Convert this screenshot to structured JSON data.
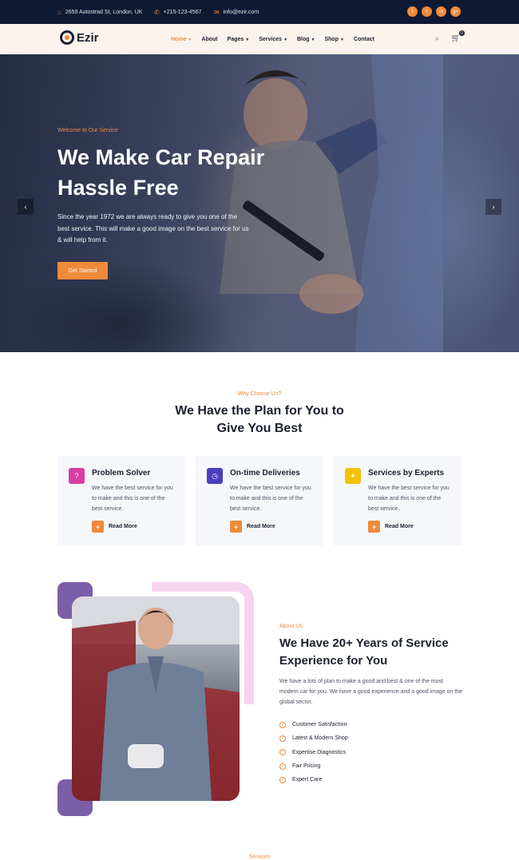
{
  "topbar": {
    "address": "2659 Autostrad St, London, UK",
    "phone": "+215-123-4567",
    "email": "info@ezir.com",
    "socials": [
      {
        "label": "f",
        "icon": "facebook-icon"
      },
      {
        "label": "t",
        "icon": "twitter-icon"
      },
      {
        "label": "in",
        "icon": "instagram-icon"
      },
      {
        "label": "g+",
        "icon": "google-plus-icon"
      }
    ]
  },
  "nav": {
    "logo": "Ezir",
    "items": [
      {
        "label": "Home",
        "dropdown": true,
        "active": true
      },
      {
        "label": "About",
        "dropdown": false
      },
      {
        "label": "Pages",
        "dropdown": true
      },
      {
        "label": "Services",
        "dropdown": true
      },
      {
        "label": "Blog",
        "dropdown": true
      },
      {
        "label": "Shop",
        "dropdown": true
      },
      {
        "label": "Contact",
        "dropdown": false
      }
    ],
    "cart_count": "0"
  },
  "hero": {
    "kicker": "Welcome to Our Service",
    "title": "We Make Car Repair Hassle Free",
    "text": "Since the year 1972 we are always ready to give you one of the best service. This will make a good image on the best service for us & will help from it.",
    "button": "Get Started",
    "prev": "‹",
    "next": "›"
  },
  "why": {
    "kicker": "Why Choose Us?",
    "title_line1": "We Have the Plan for You to",
    "title_line2": "Give You Best",
    "cards": [
      {
        "title": "Problem Solver",
        "text": "We have the best service for you to make and this is one of the best service.",
        "link": "Read More",
        "icon": "?",
        "color": "#d63ea6"
      },
      {
        "title": "On-time Deliveries",
        "text": "We have the best service for you to make and this is one of the best service.",
        "link": "Read More",
        "icon": "◷",
        "color": "#4a3fbf"
      },
      {
        "title": "Services by Experts",
        "text": "We have the best service for you to make and this is one of the best service.",
        "link": "Read More",
        "icon": "✦",
        "color": "#f2c200"
      }
    ]
  },
  "about": {
    "kicker": "About Us",
    "title": "We Have 20+ Years of Service Experience for You",
    "text": "We have a lots of plan to make a good and best & one of the most modern car for you. We have a good experience and a good image on the global sector.",
    "list": [
      "Customer Satisfaction",
      "Latest & Modern Shop",
      "Expertise Diagnostics",
      "Fair Pricing",
      "Expert Care"
    ]
  },
  "services": {
    "kicker": "Services"
  }
}
